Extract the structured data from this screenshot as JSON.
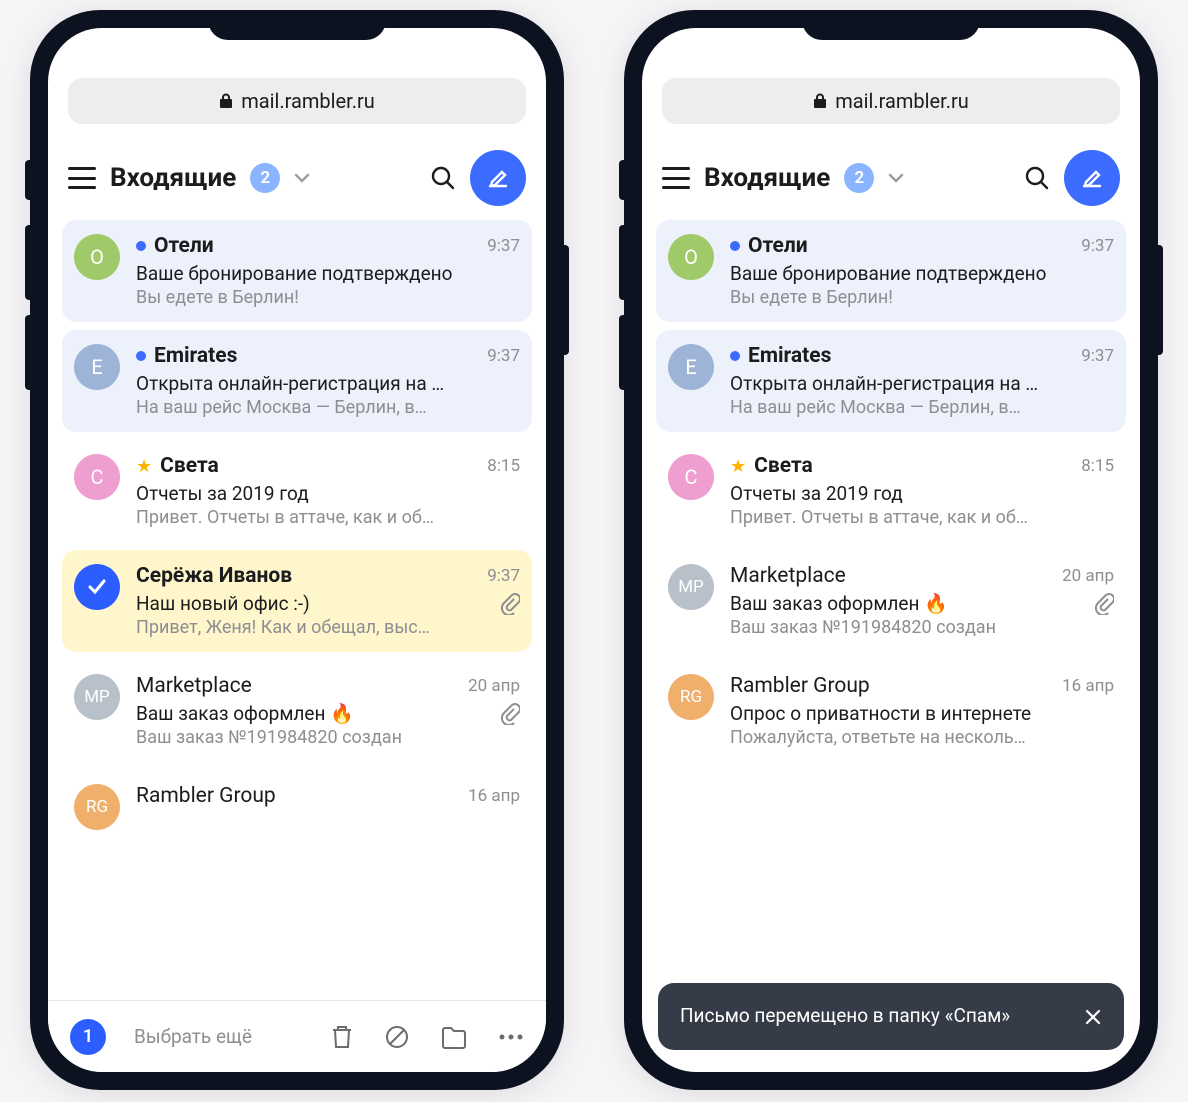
{
  "url": "mail.rambler.ru",
  "header": {
    "folder": "Входящие",
    "unread_count": "2"
  },
  "left_messages": [
    {
      "avatar_letter": "О",
      "avatar_color": "#a0c96a",
      "sender": "Отели",
      "time": "9:37",
      "subject": "Ваше бронирование подтверждено",
      "preview": "Вы едете в Берлин!",
      "unread": true,
      "selected": false,
      "starred": false,
      "attachment": false
    },
    {
      "avatar_letter": "E",
      "avatar_color": "#9db4d6",
      "sender": "Emirates",
      "time": "9:37",
      "subject": "Открыта онлайн-регистрация на …",
      "preview": "На ваш рейс Москва — Берлин, в…",
      "unread": true,
      "selected": false,
      "starred": false,
      "attachment": false
    },
    {
      "avatar_letter": "С",
      "avatar_color": "#ef9ed0",
      "sender": "Света",
      "time": "8:15",
      "subject": "Отчеты за 2019 год",
      "preview": "Привет. Отчеты в аттаче, как и об…",
      "unread": false,
      "selected": false,
      "starred": true,
      "attachment": false
    },
    {
      "avatar_letter": "",
      "avatar_color": "#2b5dff",
      "sender": "Серёжа Иванов",
      "time": "9:37",
      "subject": "Наш новый офис :-)",
      "preview": "Привет, Женя! Как и обещал, выс…",
      "unread": false,
      "selected": true,
      "starred": false,
      "attachment": true
    },
    {
      "avatar_letter": "MP",
      "avatar_color": "#b8c0ca",
      "sender": "Marketplace",
      "time": "20 апр",
      "subject": "Ваш заказ оформлен 🔥",
      "preview": "Ваш заказ №191984820 создан",
      "unread": false,
      "selected": false,
      "starred": false,
      "attachment": true
    },
    {
      "avatar_letter": "RG",
      "avatar_color": "#f0b06b",
      "sender": "Rambler Group",
      "time": "16 апр",
      "subject": "",
      "preview": "",
      "unread": false,
      "selected": false,
      "starred": false,
      "attachment": false,
      "cutoff": true
    }
  ],
  "right_messages": [
    {
      "avatar_letter": "О",
      "avatar_color": "#a0c96a",
      "sender": "Отели",
      "time": "9:37",
      "subject": "Ваше бронирование подтверждено",
      "preview": "Вы едете в Берлин!",
      "unread": true,
      "starred": false,
      "attachment": false
    },
    {
      "avatar_letter": "E",
      "avatar_color": "#9db4d6",
      "sender": "Emirates",
      "time": "9:37",
      "subject": "Открыта онлайн-регистрация на …",
      "preview": "На ваш рейс Москва — Берлин, в…",
      "unread": true,
      "starred": false,
      "attachment": false
    },
    {
      "avatar_letter": "С",
      "avatar_color": "#ef9ed0",
      "sender": "Света",
      "time": "8:15",
      "subject": "Отчеты за 2019 год",
      "preview": "Привет. Отчеты в аттаче, как и об…",
      "unread": false,
      "starred": true,
      "attachment": false
    },
    {
      "avatar_letter": "MP",
      "avatar_color": "#b8c0ca",
      "sender": "Marketplace",
      "time": "20 апр",
      "subject": "Ваш заказ оформлен 🔥",
      "preview": "Ваш заказ №191984820 создан",
      "unread": false,
      "starred": false,
      "attachment": true
    },
    {
      "avatar_letter": "RG",
      "avatar_color": "#f0b06b",
      "sender": "Rambler Group",
      "time": "16 апр",
      "subject": "Опрос о приватности в интернете",
      "preview": "Пожалуйста, ответьте на несколь…",
      "unread": false,
      "starred": false,
      "attachment": false
    }
  ],
  "toolbar": {
    "selected_count": "1",
    "select_more": "Выбрать ещё"
  },
  "toast": {
    "text": "Письмо перемещено в папку «Спам»"
  }
}
